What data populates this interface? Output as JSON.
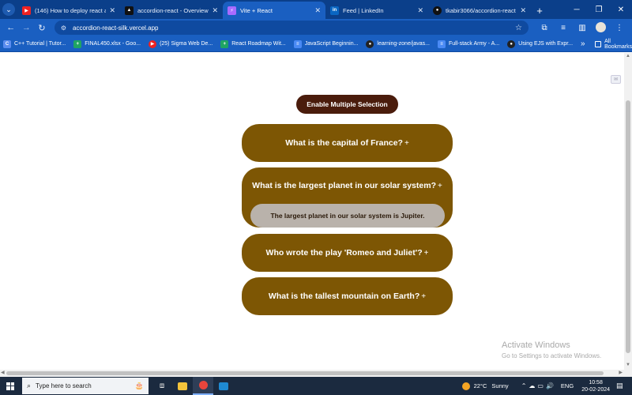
{
  "browser": {
    "tabs": [
      {
        "title": "(146) How to deploy react app",
        "favicon": "youtube-icon",
        "color": "#e22"
      },
      {
        "title": "accordion-react - Overview - V",
        "favicon": "vercel-icon",
        "color": "#111"
      },
      {
        "title": "Vite + React",
        "favicon": "vite-icon",
        "color": "#a86bff",
        "active": true
      },
      {
        "title": "Feed | LinkedIn",
        "favicon": "linkedin-icon",
        "color": "#0a66c2"
      },
      {
        "title": "tkabir3066/accordion-react",
        "favicon": "github-icon",
        "color": "#111"
      }
    ],
    "url": "accordion-react-silk.vercel.app",
    "bookmarks": [
      {
        "label": "C++ Tutorial | Tutor...",
        "icon": "bookmark-icon",
        "color": "#5b8def"
      },
      {
        "label": "FINAL450.xlsx - Goo...",
        "icon": "sheets-icon",
        "color": "#1fa463"
      },
      {
        "label": "(25) Sigma Web De...",
        "icon": "youtube-icon",
        "color": "#e22"
      },
      {
        "label": "React Roadmap Wit...",
        "icon": "sheets-icon",
        "color": "#1fa463"
      },
      {
        "label": "JavaScript Beginnin...",
        "icon": "docs-icon",
        "color": "#4a8af4"
      },
      {
        "label": "learning-zone/javas...",
        "icon": "github-icon",
        "color": "#222"
      },
      {
        "label": "Full-stack Army - A...",
        "icon": "docs-icon",
        "color": "#4a8af4"
      },
      {
        "label": "Using EJS with Expr...",
        "icon": "github-icon",
        "color": "#222"
      }
    ],
    "all_bookmarks": "All Bookmarks"
  },
  "page": {
    "multi_select_button": "Enable Multiple Selection",
    "accordion": [
      {
        "question": "What is the capital of France?",
        "toggle": "+",
        "open": false
      },
      {
        "question": "What is the largest planet in our solar system?",
        "toggle": "+",
        "open": true,
        "answer": "The largest planet in our solar system is Jupiter."
      },
      {
        "question": "Who wrote the play 'Romeo and Juliet'?",
        "toggle": "+",
        "open": false
      },
      {
        "question": "What is the tallest mountain on Earth?",
        "toggle": "+",
        "open": false
      }
    ],
    "colors": {
      "item_bg": "#7d5604",
      "button_bg": "#4a1c0c",
      "answer_bg": "#b9b2ab"
    }
  },
  "watermark": {
    "line1": "Activate Windows",
    "line2": "Go to Settings to activate Windows."
  },
  "taskbar": {
    "search_placeholder": "Type here to search",
    "weather_temp": "22°C",
    "weather_desc": "Sunny",
    "language": "ENG",
    "time": "10:58",
    "date": "20-02-2024"
  }
}
